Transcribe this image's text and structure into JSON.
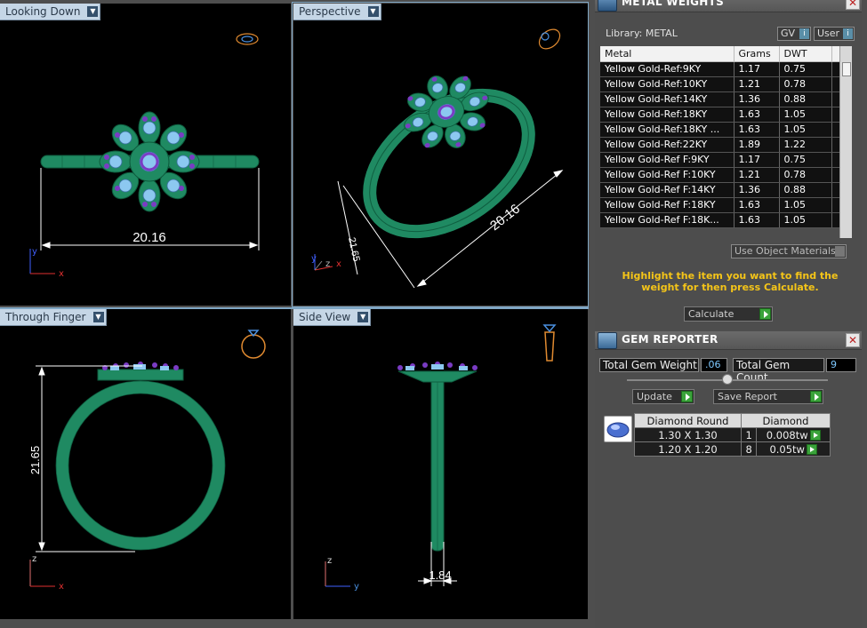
{
  "viewports": {
    "top_left": {
      "title": "Looking Down",
      "dimension": "20.16",
      "axis_a": "y",
      "axis_b": "x"
    },
    "top_right": {
      "title": "Perspective",
      "dimension_a": "20.16",
      "dimension_b": "21.65",
      "axis_a": "y",
      "axis_b": "z",
      "axis_c": "x"
    },
    "bottom_left": {
      "title": "Through Finger",
      "dimension": "21.65",
      "axis_a": "z",
      "axis_b": "x"
    },
    "bottom_right": {
      "title": "Side View",
      "dimension": "1.84",
      "axis_a": "z",
      "axis_b": "y"
    }
  },
  "metal_weights": {
    "title": "METAL WEIGHTS",
    "library_label": "Library: METAL",
    "gv_label": "GV",
    "user_label": "User",
    "columns": [
      "Metal",
      "Grams",
      "DWT"
    ],
    "rows": [
      [
        "Yellow Gold-Ref:9KY",
        "1.17",
        "0.75"
      ],
      [
        "Yellow Gold-Ref:10KY",
        "1.21",
        "0.78"
      ],
      [
        "Yellow Gold-Ref:14KY",
        "1.36",
        "0.88"
      ],
      [
        "Yellow Gold-Ref:18KY",
        "1.63",
        "1.05"
      ],
      [
        "Yellow Gold-Ref:18KY ...",
        "1.63",
        "1.05"
      ],
      [
        "Yellow Gold-Ref:22KY",
        "1.89",
        "1.22"
      ],
      [
        "Yellow Gold-Ref F:9KY",
        "1.17",
        "0.75"
      ],
      [
        "Yellow Gold-Ref F:10KY",
        "1.21",
        "0.78"
      ],
      [
        "Yellow Gold-Ref F:14KY",
        "1.36",
        "0.88"
      ],
      [
        "Yellow Gold-Ref F:18KY",
        "1.63",
        "1.05"
      ],
      [
        "Yellow Gold-Ref F:18K...",
        "1.63",
        "1.05"
      ]
    ],
    "use_object_materials": "Use Object Materials",
    "hint": "Highlight the item you want to find the weight for then press Calculate.",
    "calculate_label": "Calculate"
  },
  "gem_reporter": {
    "title": "GEM REPORTER",
    "total_weight_label": "Total Gem Weight",
    "total_weight_value": ".06",
    "total_count_label": "Total Gem Count",
    "total_count_value": "9",
    "update_label": "Update",
    "save_report_label": "Save Report",
    "headers": [
      "Diamond Round",
      "Diamond"
    ],
    "rows": [
      [
        "1.30 X 1.30",
        "1",
        "0.008tw"
      ],
      [
        "1.20 X 1.20",
        "8",
        "0.05tw"
      ]
    ]
  },
  "colors": {
    "ring": "#1f8a62",
    "stone": "#8cc8f0",
    "prong": "#7a3cc4",
    "dimension": "#ffffff",
    "accent_hint": "#f5c518"
  }
}
